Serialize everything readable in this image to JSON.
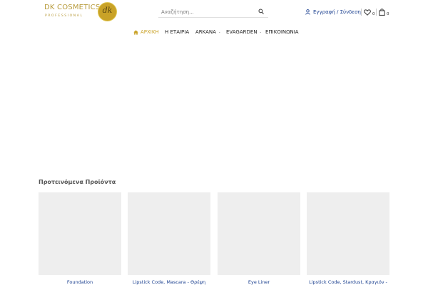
{
  "header": {
    "logo_text": "DK COSMETICS",
    "logo_tagline": "PROFESSIONAL",
    "logo_mark": "dk",
    "search_placeholder": "Αναζήτηση...",
    "account_label": "Εγγραφή / Σύνδεση",
    "wishlist_count": "0",
    "cart_count": "0"
  },
  "nav": {
    "items": [
      {
        "label": "ΑΡΧΙΚΗ",
        "active": true
      },
      {
        "label": "Η ΕΤΑΙΡΙΑ"
      },
      {
        "label": "ARKANA"
      },
      {
        "label": "EVAGARDEN"
      },
      {
        "label": "ΕΠΙΚΟΙΝΩΝΙΑ"
      }
    ]
  },
  "featured": {
    "title": "Προτεινόμενα Προϊόντα",
    "products": [
      {
        "name": "Foundation"
      },
      {
        "name": "Lipstick Code, Mascara - Θρέψη"
      },
      {
        "name": "Eye Liner"
      },
      {
        "name": "Lipstick Code, Stardust, Κραγιόν -"
      }
    ]
  },
  "colors": {
    "brand_gold": "#c9a227",
    "link_blue": "#1a3f8f",
    "placeholder_grey": "#eeeeee"
  }
}
